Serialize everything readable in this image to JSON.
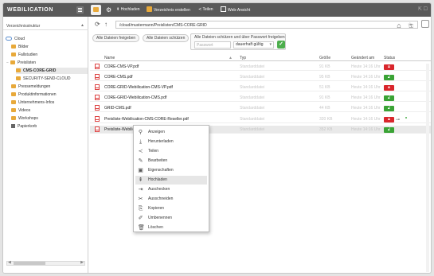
{
  "brand": {
    "title": "Webilication"
  },
  "toolbar": {
    "upload": "Hochladen",
    "new_folder": "Verzeichnis erstellen",
    "share": "Teilen",
    "web_view": "Web-Ansicht"
  },
  "address": {
    "url": "/cloud/mustermann/Preislisten/CMS-CORE-GRID"
  },
  "share_bar": {
    "share_all": "Alle Dateien freigeben",
    "protect_all": "Alle Dateien schützen",
    "pw_label": "Alle Dateien schützen und über Passwort freigeben",
    "pw_placeholder": "Passwort",
    "validity": "dauerhaft gültig"
  },
  "sidebar": {
    "header": "Verzeichnisstruktur",
    "items": [
      {
        "label": "Cloud"
      },
      {
        "label": "Bilder"
      },
      {
        "label": "Fallstudien"
      },
      {
        "label": "Preislisten"
      },
      {
        "label": "CMS-CORE-GRID"
      },
      {
        "label": "SECURITY-SEND-CLOUD"
      },
      {
        "label": "Pressemeldungen"
      },
      {
        "label": "Produktinformationen"
      },
      {
        "label": "Unternehmens-Infos"
      },
      {
        "label": "Videos"
      },
      {
        "label": "Workshops"
      },
      {
        "label": "Papierkorb"
      }
    ]
  },
  "table": {
    "columns": {
      "name": "Name",
      "type": "Typ",
      "size": "Größe",
      "date": "Geändert am",
      "status": "Status"
    },
    "rows": [
      {
        "name": "CORE-CMS-VP.pdf",
        "type": "Standarddatei",
        "size": "91 KB",
        "date": "Heute 14:16 Uhr",
        "status": "locked"
      },
      {
        "name": "CORE-CMS.pdf",
        "type": "Standarddatei",
        "size": "95 KB",
        "date": "Heute 14:16 Uhr",
        "status": "unlocked"
      },
      {
        "name": "CORE-GRID-Webilication-CMS-VP.pdf",
        "type": "Standarddatei",
        "size": "51 KB",
        "date": "Heute 14:16 Uhr",
        "status": "locked"
      },
      {
        "name": "CORE-GRID-Webilication-CMS.pdf",
        "type": "Standarddatei",
        "size": "91 KB",
        "date": "Heute 14:16 Uhr",
        "status": "unlocked"
      },
      {
        "name": "GRID-CMS.pdf",
        "type": "Standarddatei",
        "size": "44 KB",
        "date": "Heute 14:16 Uhr",
        "status": "unlocked"
      },
      {
        "name": "Preisliste-Webilication-CMS-CORE-Reseller.pdf",
        "type": "Standarddatei",
        "size": "320 KB",
        "date": "Heute 14:16 Uhr",
        "status": "locked"
      },
      {
        "name": "Preisliste-Webilication-CMS-CORE.pdf",
        "type": "Standarddatei",
        "size": "352 KB",
        "date": "Heute 14:16 Uhr",
        "status": "unlocked"
      }
    ]
  },
  "context_menu": {
    "items": [
      {
        "label": "Anzeigen",
        "icon": "magnifier-icon"
      },
      {
        "label": "Herunterladen",
        "icon": "download-icon"
      },
      {
        "label": "Teilen",
        "icon": "share-icon"
      },
      {
        "label": "Bearbeiten",
        "icon": "pencil-icon"
      },
      {
        "label": "Eigenschaften",
        "icon": "properties-icon"
      },
      {
        "label": "Hochladen",
        "icon": "upload-icon"
      },
      {
        "label": "Auschecken",
        "icon": "checkout-icon"
      },
      {
        "label": "Ausschneiden",
        "icon": "scissors-icon"
      },
      {
        "label": "Kopieren",
        "icon": "copy-icon"
      },
      {
        "label": "Umbenennen",
        "icon": "rename-icon"
      },
      {
        "label": "Löschen",
        "icon": "trash-icon"
      }
    ]
  },
  "colors": {
    "header_bg": "#5a5a5a",
    "locked": "#d9262c",
    "unlocked": "#3aa335",
    "folder": "#e8a93a"
  }
}
